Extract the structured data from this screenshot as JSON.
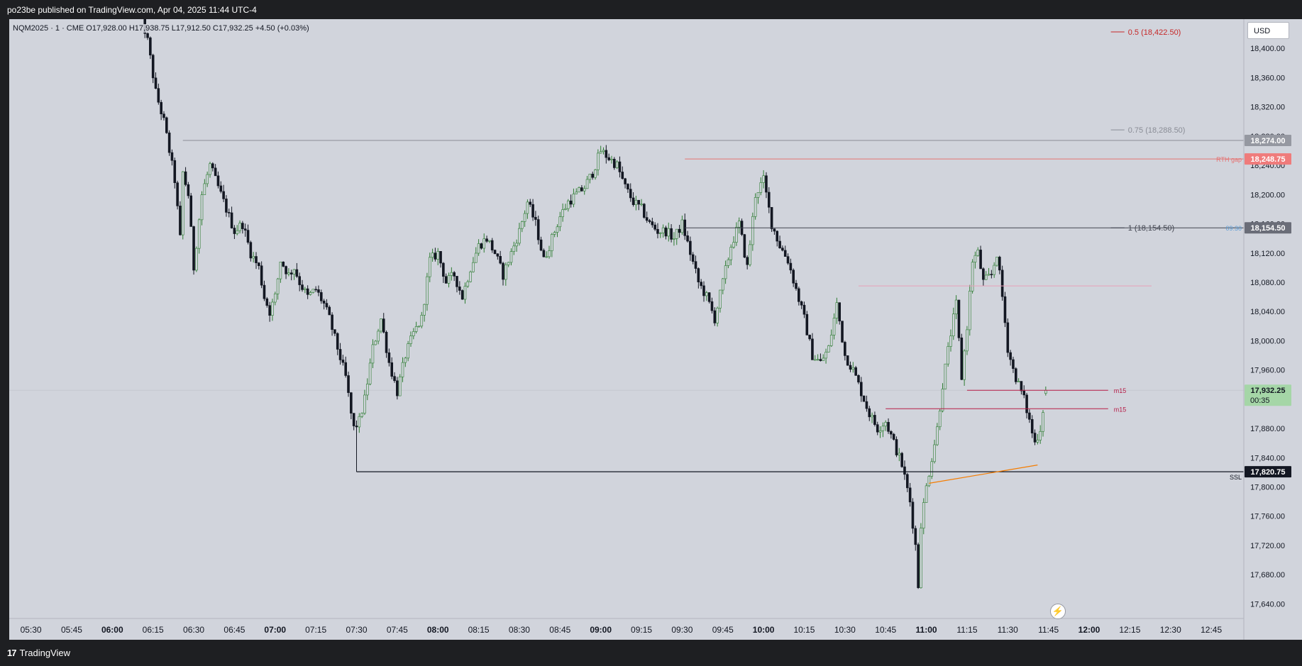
{
  "header": {
    "publisher_text": "po23be published on TradingView.com, Apr 04, 2025 11:44 UTC-4"
  },
  "footer": {
    "brand_logo": "17",
    "brand_name": "TradingView"
  },
  "legend": {
    "text": "NQM2025 · 1 · CME  O17,928.00  H17,938.75  L17,912.50  C17,932.25  +4.50 (+0.03%)"
  },
  "price_axis": {
    "currency": "USD"
  },
  "colors": {
    "background": "#d1d4dc",
    "up_wick": "#2e7d32",
    "down_candle": "#131722",
    "up_candle": "#d1d4dc",
    "fib_05": "#c62828",
    "fib_075": "#8a8d96",
    "fib_1": "#434651",
    "rth_gap": "#e57373",
    "m15": "#b71c47",
    "ssl": "#131722",
    "trendline": "#f57c00",
    "current_price": "#a5d6a7"
  },
  "chart_data": {
    "type": "candlestick",
    "symbol": "NQM2025",
    "interval": "1",
    "exchange": "CME",
    "ohlc": {
      "open": 17928.0,
      "high": 17938.75,
      "low": 17912.5,
      "close": 17932.25,
      "change": "+4.50 (+0.03%)"
    },
    "ylim": [
      17620,
      18440
    ],
    "y_ticks": [
      18400,
      18360,
      18320,
      18280,
      18240,
      18200,
      18160,
      18120,
      18080,
      18040,
      18000,
      17960,
      17920,
      17880,
      17840,
      17800,
      17760,
      17720,
      17680,
      17640
    ],
    "y_tick_labels": [
      "18,400.00",
      "18,360.00",
      "18,320.00",
      "18,280.00",
      "18,240.00",
      "18,200.00",
      "18,160.00",
      "18,120.00",
      "18,080.00",
      "18,040.00",
      "18,000.00",
      "17,960.00",
      "17,920.00",
      "17,880.00",
      "17,840.00",
      "17,800.00",
      "17,760.00",
      "17,720.00",
      "17,680.00",
      "17,640.00"
    ],
    "x_range": [
      "05:22",
      "12:57"
    ],
    "x_ticks": [
      {
        "time": "05:30",
        "label": "05:30",
        "bold": false
      },
      {
        "time": "05:45",
        "label": "05:45",
        "bold": false
      },
      {
        "time": "06:00",
        "label": "06:00",
        "bold": true
      },
      {
        "time": "06:15",
        "label": "06:15",
        "bold": false
      },
      {
        "time": "06:30",
        "label": "06:30",
        "bold": false
      },
      {
        "time": "06:45",
        "label": "06:45",
        "bold": false
      },
      {
        "time": "07:00",
        "label": "07:00",
        "bold": true
      },
      {
        "time": "07:15",
        "label": "07:15",
        "bold": false
      },
      {
        "time": "07:30",
        "label": "07:30",
        "bold": false
      },
      {
        "time": "07:45",
        "label": "07:45",
        "bold": false
      },
      {
        "time": "08:00",
        "label": "08:00",
        "bold": true
      },
      {
        "time": "08:15",
        "label": "08:15",
        "bold": false
      },
      {
        "time": "08:30",
        "label": "08:30",
        "bold": false
      },
      {
        "time": "08:45",
        "label": "08:45",
        "bold": false
      },
      {
        "time": "09:00",
        "label": "09:00",
        "bold": true
      },
      {
        "time": "09:15",
        "label": "09:15",
        "bold": false
      },
      {
        "time": "09:30",
        "label": "09:30",
        "bold": false
      },
      {
        "time": "09:45",
        "label": "09:45",
        "bold": false
      },
      {
        "time": "10:00",
        "label": "10:00",
        "bold": true
      },
      {
        "time": "10:15",
        "label": "10:15",
        "bold": false
      },
      {
        "time": "10:30",
        "label": "10:30",
        "bold": false
      },
      {
        "time": "10:45",
        "label": "10:45",
        "bold": false
      },
      {
        "time": "11:00",
        "label": "11:00",
        "bold": true
      },
      {
        "time": "11:15",
        "label": "11:15",
        "bold": false
      },
      {
        "time": "11:30",
        "label": "11:30",
        "bold": false
      },
      {
        "time": "11:45",
        "label": "11:45",
        "bold": false
      },
      {
        "time": "12:00",
        "label": "12:00",
        "bold": true
      },
      {
        "time": "12:15",
        "label": "12:15",
        "bold": false
      },
      {
        "time": "12:30",
        "label": "12:30",
        "bold": false
      },
      {
        "time": "12:45",
        "label": "12:45",
        "bold": false
      }
    ],
    "price_path": [
      [
        "06:10",
        18455
      ],
      [
        "06:13",
        18410
      ],
      [
        "06:16",
        18340
      ],
      [
        "06:19",
        18300
      ],
      [
        "06:23",
        18220
      ],
      [
        "06:25",
        18140
      ],
      [
        "06:26",
        18230
      ],
      [
        "06:28",
        18200
      ],
      [
        "06:30",
        18100
      ],
      [
        "06:33",
        18200
      ],
      [
        "06:36",
        18240
      ],
      [
        "06:39",
        18210
      ],
      [
        "06:42",
        18180
      ],
      [
        "06:45",
        18150
      ],
      [
        "06:48",
        18160
      ],
      [
        "06:51",
        18120
      ],
      [
        "06:54",
        18100
      ],
      [
        "06:56",
        18060
      ],
      [
        "06:58",
        18040
      ],
      [
        "07:00",
        18060
      ],
      [
        "07:02",
        18110
      ],
      [
        "07:05",
        18090
      ],
      [
        "07:07",
        18100
      ],
      [
        "07:09",
        18080
      ],
      [
        "07:12",
        18060
      ],
      [
        "07:15",
        18070
      ],
      [
        "07:18",
        18050
      ],
      [
        "07:20",
        18030
      ],
      [
        "07:23",
        17990
      ],
      [
        "07:26",
        17950
      ],
      [
        "07:28",
        17900
      ],
      [
        "07:29",
        17880
      ],
      [
        "07:31",
        17890
      ],
      [
        "07:33",
        17920
      ],
      [
        "07:36",
        17990
      ],
      [
        "07:39",
        18030
      ],
      [
        "07:42",
        17970
      ],
      [
        "07:45",
        17930
      ],
      [
        "07:48",
        17980
      ],
      [
        "07:51",
        18010
      ],
      [
        "07:54",
        18030
      ],
      [
        "07:57",
        18110
      ],
      [
        "08:00",
        18120
      ],
      [
        "08:03",
        18080
      ],
      [
        "08:06",
        18090
      ],
      [
        "08:09",
        18060
      ],
      [
        "08:12",
        18100
      ],
      [
        "08:15",
        18130
      ],
      [
        "08:18",
        18140
      ],
      [
        "08:21",
        18120
      ],
      [
        "08:24",
        18090
      ],
      [
        "08:27",
        18120
      ],
      [
        "08:30",
        18150
      ],
      [
        "08:33",
        18190
      ],
      [
        "08:36",
        18160
      ],
      [
        "08:39",
        18110
      ],
      [
        "08:42",
        18140
      ],
      [
        "08:45",
        18170
      ],
      [
        "08:48",
        18190
      ],
      [
        "08:51",
        18200
      ],
      [
        "08:54",
        18210
      ],
      [
        "08:57",
        18230
      ],
      [
        "09:00",
        18260
      ],
      [
        "09:03",
        18250
      ],
      [
        "09:06",
        18240
      ],
      [
        "09:09",
        18210
      ],
      [
        "09:12",
        18190
      ],
      [
        "09:15",
        18180
      ],
      [
        "09:18",
        18160
      ],
      [
        "09:21",
        18150
      ],
      [
        "09:24",
        18150
      ],
      [
        "09:27",
        18140
      ],
      [
        "09:30",
        18160
      ],
      [
        "09:33",
        18120
      ],
      [
        "09:36",
        18080
      ],
      [
        "09:39",
        18060
      ],
      [
        "09:42",
        18030
      ],
      [
        "09:45",
        18080
      ],
      [
        "09:48",
        18130
      ],
      [
        "09:51",
        18160
      ],
      [
        "09:54",
        18100
      ],
      [
        "09:57",
        18200
      ],
      [
        "10:00",
        18220
      ],
      [
        "10:03",
        18160
      ],
      [
        "10:06",
        18130
      ],
      [
        "10:09",
        18110
      ],
      [
        "10:12",
        18070
      ],
      [
        "10:15",
        18030
      ],
      [
        "10:18",
        17980
      ],
      [
        "10:21",
        17970
      ],
      [
        "10:24",
        17990
      ],
      [
        "10:27",
        18050
      ],
      [
        "10:30",
        17980
      ],
      [
        "10:33",
        17960
      ],
      [
        "10:36",
        17930
      ],
      [
        "10:39",
        17900
      ],
      [
        "10:42",
        17880
      ],
      [
        "10:45",
        17890
      ],
      [
        "10:48",
        17860
      ],
      [
        "10:51",
        17830
      ],
      [
        "10:54",
        17780
      ],
      [
        "10:56",
        17720
      ],
      [
        "10:57",
        17665
      ],
      [
        "10:58",
        17750
      ],
      [
        "11:00",
        17800
      ],
      [
        "11:02",
        17840
      ],
      [
        "11:04",
        17880
      ],
      [
        "11:06",
        17940
      ],
      [
        "11:09",
        18010
      ],
      [
        "11:11",
        18050
      ],
      [
        "11:13",
        17950
      ],
      [
        "11:15",
        18020
      ],
      [
        "11:17",
        18110
      ],
      [
        "11:19",
        18120
      ],
      [
        "11:21",
        18080
      ],
      [
        "11:24",
        18090
      ],
      [
        "11:26",
        18120
      ],
      [
        "11:28",
        18060
      ],
      [
        "11:30",
        17990
      ],
      [
        "11:32",
        17960
      ],
      [
        "11:34",
        17940
      ],
      [
        "11:36",
        17920
      ],
      [
        "11:38",
        17890
      ],
      [
        "11:40",
        17860
      ],
      [
        "11:42",
        17880
      ],
      [
        "11:44",
        17932
      ]
    ],
    "levels": [
      {
        "price": 18422.5,
        "label": "0.5 (18,422.50)",
        "kind": "fib",
        "color": "#c62828",
        "x_start": "12:08",
        "x_end": "12:13"
      },
      {
        "price": 18288.5,
        "label": "0.75 (18,288.50)",
        "kind": "fib",
        "color": "#8a8d96",
        "x_start": "12:08",
        "x_end": "12:13"
      },
      {
        "price": 18274.0,
        "label": "",
        "kind": "hline",
        "color": "#8a8d96",
        "x_start": "06:26",
        "x_end": "12:57"
      },
      {
        "price": 18248.75,
        "label": "RTH gap",
        "kind": "ray",
        "color": "#e57373",
        "x_start": "09:31",
        "x_end": "12:57"
      },
      {
        "price": 18154.5,
        "label": "1 (18,154.50)",
        "kind": "fib",
        "color": "#434651",
        "x_start": "09:31",
        "x_end": "12:57"
      },
      {
        "price": 18075.0,
        "label": "",
        "kind": "ray",
        "color": "#e8a0b8",
        "x_start": "10:35",
        "x_end": "12:23"
      },
      {
        "price": 17932.25,
        "label": "m15",
        "kind": "ray",
        "color": "#b71c47",
        "x_start": "11:15",
        "x_end": "12:07"
      },
      {
        "price": 17907.0,
        "label": "m15",
        "kind": "ray",
        "color": "#b71c47",
        "x_start": "10:45",
        "x_end": "12:07"
      },
      {
        "price": 17820.75,
        "label": "SSL",
        "kind": "ray",
        "color": "#131722",
        "x_start": "07:30",
        "x_end": "12:57"
      }
    ],
    "session_label": "09:30",
    "trendline": {
      "from": [
        "11:01",
        17805
      ],
      "to": [
        "11:41",
        17830
      ],
      "color": "#f57c00"
    },
    "price_badges": [
      {
        "price": 18274.0,
        "text": "18,274.00",
        "bg": "#9598a1",
        "fg": "#ffffff"
      },
      {
        "price": 18248.75,
        "text": "18,248.75",
        "bg": "#ef7b7b",
        "fg": "#ffffff"
      },
      {
        "price": 18154.5,
        "text": "18,154.50",
        "bg": "#6a6d78",
        "fg": "#ffffff"
      },
      {
        "price": 17932.25,
        "text": "17,932.25",
        "subtext": "00:35",
        "bg": "#a5d6a7",
        "fg": "#131722"
      },
      {
        "price": 17820.75,
        "text": "17,820.75",
        "bg": "#131722",
        "fg": "#ffffff"
      }
    ]
  }
}
